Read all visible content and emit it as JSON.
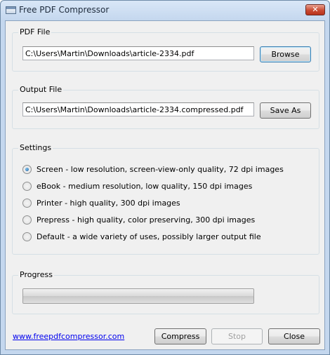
{
  "window": {
    "title": "Free PDF Compressor",
    "close_glyph": "✕"
  },
  "pdf_file": {
    "label": "PDF File",
    "value": "C:\\Users\\Martin\\Downloads\\article-2334.pdf",
    "browse_label": "Browse"
  },
  "output_file": {
    "label": "Output File",
    "value": "C:\\Users\\Martin\\Downloads\\article-2334.compressed.pdf",
    "save_as_label": "Save As"
  },
  "settings": {
    "label": "Settings",
    "selected": "Screen",
    "options": [
      {
        "label": "Screen - low resolution, screen-view-only quality, 72 dpi images",
        "checked": true
      },
      {
        "label": "eBook - medium resolution, low quality, 150 dpi images",
        "checked": false
      },
      {
        "label": "Printer - high quality, 300 dpi images",
        "checked": false
      },
      {
        "label": "Prepress - high quality, color preserving, 300 dpi images",
        "checked": false
      },
      {
        "label": "Default - a wide variety of uses, possibly larger output file",
        "checked": false
      }
    ]
  },
  "progress": {
    "label": "Progress",
    "value": 0
  },
  "footer": {
    "link_text": "www.freepdfcompressor.com",
    "compress_label": "Compress",
    "stop_label": "Stop",
    "close_label": "Close"
  }
}
